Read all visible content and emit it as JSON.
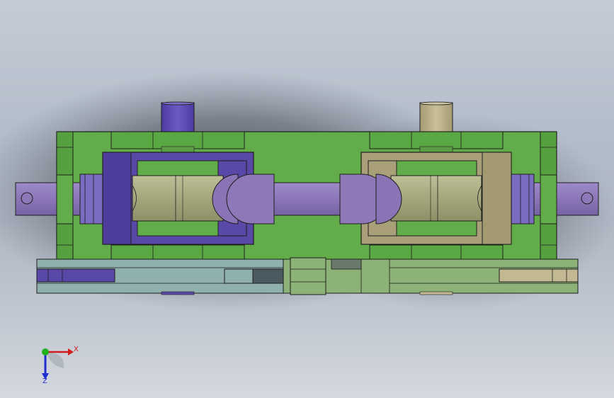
{
  "view": {
    "background_top": "#c3cbd6",
    "background_bottom": "#d4d8df"
  },
  "colors": {
    "frame_green": "#62ad4a",
    "frame_green_dark": "#4f9a3a",
    "left_purple": "#5a48a8",
    "left_purple_light": "#7a6cc0",
    "right_khaki": "#a9a07a",
    "shaft_lavender": "#8e78b8",
    "roller_olive": "#a9aa80",
    "lower_blue": "#8fb0ad",
    "lower_green": "#8cb277",
    "outline": "#1e1e1e"
  },
  "triad": {
    "x_label": "X",
    "z_label": "Z",
    "x_color": "#d01e1e",
    "y_color": "#20b020",
    "z_color": "#1e2ed0"
  }
}
